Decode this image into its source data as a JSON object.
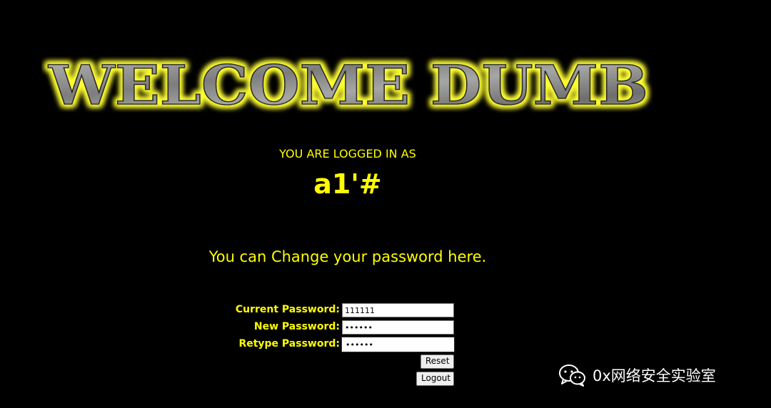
{
  "banner": {
    "text": "WELCOME DUMB"
  },
  "session": {
    "logged_in_label": "YOU ARE LOGGED IN AS",
    "username": "a1'#"
  },
  "change_password": {
    "heading": "You can Change your password here.",
    "current_label": "Current Password:",
    "current_value": "111111",
    "new_label": "New Password:",
    "new_value": "111111",
    "retype_label": "Retype Password:",
    "retype_value": "111111",
    "reset_label": "Reset",
    "logout_label": "Logout"
  },
  "watermark": {
    "icon": "wechat-icon",
    "text": "0x网络安全实验室"
  },
  "colors": {
    "background": "#000000",
    "text_accent": "#ffff00",
    "banner_glow": "#ffff33"
  }
}
